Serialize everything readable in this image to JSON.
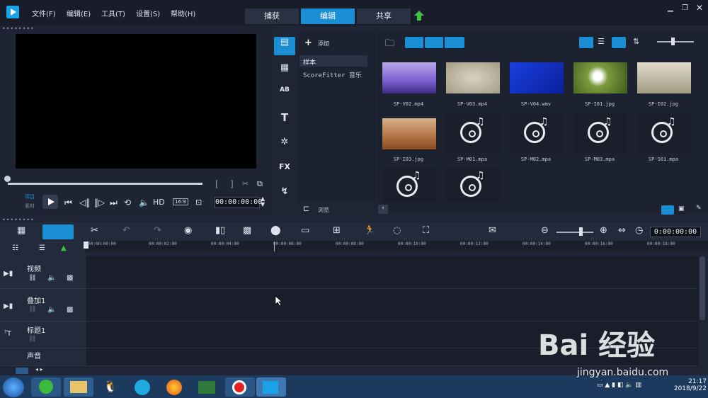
{
  "menu": {
    "file": "文件(F)",
    "edit": "编辑(E)",
    "tools": "工具(T)",
    "settings": "设置(S)",
    "help": "帮助(H)"
  },
  "tabs": {
    "capture": "捕获",
    "edit": "编辑",
    "share": "共享"
  },
  "preview": {
    "project_label": "项目",
    "clip_label": "素材",
    "hd": "HD",
    "ratio": "16:9",
    "timecode": "00:00:00:00"
  },
  "library": {
    "add": "添加",
    "browse": "浏览",
    "folders": [
      "样本",
      "ScoreFitter 音乐"
    ],
    "items": [
      {
        "name": "SP-V02.mp4"
      },
      {
        "name": "SP-V03.mp4"
      },
      {
        "name": "SP-V04.wmv"
      },
      {
        "name": "SP-I01.jpg"
      },
      {
        "name": "SP-I02.jpg"
      },
      {
        "name": "SP-I03.jpg"
      },
      {
        "name": "SP-M01.mpa"
      },
      {
        "name": "SP-M02.mpa"
      },
      {
        "name": "SP-M03.mpa"
      },
      {
        "name": "SP-S01.mpa"
      }
    ]
  },
  "timeline": {
    "timecode": "0:00:00:00",
    "ticks": [
      "00:00:00:00",
      "00:00:02:00",
      "00:00:04:00",
      "00:00:06:00",
      "00:00:08:00",
      "00:00:10:00",
      "00:00:12:00",
      "00:00:14:00",
      "00:00:16:00",
      "00:00:18:00"
    ],
    "tracks": [
      "视频",
      "叠加1",
      "标题1",
      "声音"
    ]
  },
  "taskbar": {
    "time": "21:17",
    "date": "2018/9/22"
  },
  "watermark": {
    "logo": "Bai 经验",
    "url": "jingyan.baidu.com"
  },
  "colors": {
    "accent": "#1b8fd6"
  }
}
